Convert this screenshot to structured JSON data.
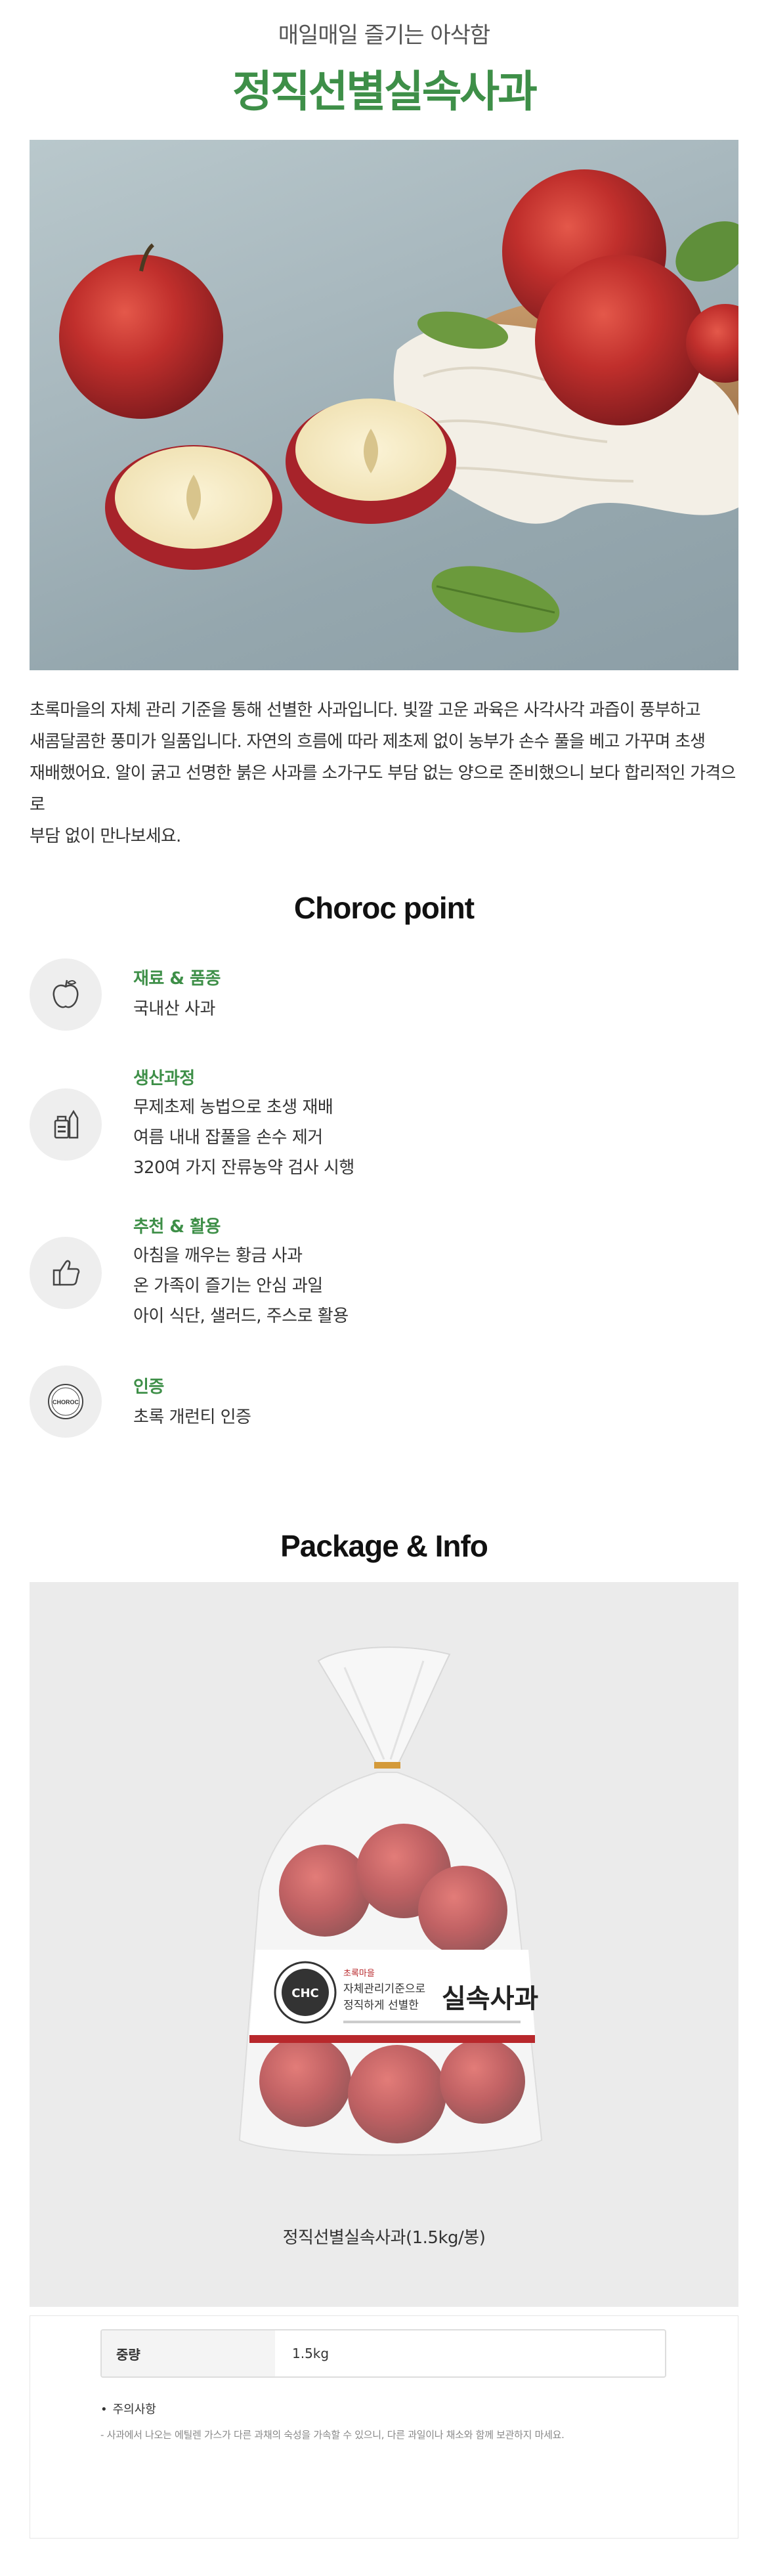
{
  "header": {
    "subtitle": "매일매일 즐기는 아삭함",
    "title": "정직선별실속사과"
  },
  "intro": {
    "lines": [
      "초록마을의 자체 관리 기준을 통해 선별한 사과입니다. 빛깔 고운 과육은 사각사각 과즙이 풍부하고",
      "새콤달콤한 풍미가 일품입니다. 자연의 흐름에 따라 제초제 없이 농부가 손수 풀을 베고 가꾸며 초생",
      "재배했어요. 알이 굵고 선명한 붉은 사과를 소가구도 부담 없는 양으로 준비했으니 보다 합리적인 가격으로",
      "부담 없이 만나보세요."
    ]
  },
  "points": {
    "heading": "Choroc point",
    "items": [
      {
        "icon": "apple-icon",
        "title": "재료 & 품종",
        "lines": [
          "국내산 사과"
        ]
      },
      {
        "icon": "bottle-icon",
        "title": "생산과정",
        "lines": [
          "무제초제 농법으로 초생 재배",
          "여름 내내 잡풀을 손수 제거",
          "320여 가지 잔류농약 검사 시행"
        ]
      },
      {
        "icon": "thumbs-up-icon",
        "title": "추천 & 활용",
        "lines": [
          "아침을 깨우는 황금 사과",
          "온 가족이 즐기는 안심 과일",
          "아이 식단, 샐러드, 주스로 활용"
        ]
      },
      {
        "icon": "choroc-badge-icon",
        "title": "인증",
        "lines": [
          "초록 개런티 인증"
        ],
        "badge_text": "CHOROC"
      }
    ]
  },
  "package": {
    "heading": "Package & Info",
    "caption": "정직선별실속사과(1.5kg/봉)",
    "label_brand": "초록마을",
    "label_line1": "자체관리기준으로",
    "label_line2": "정직하게 선별한",
    "label_name": "실속사과"
  },
  "info": {
    "spec_key": "중량",
    "spec_value": "1.5kg",
    "notice_title": "주의사항",
    "notice_text": "- 사과에서 나오는 에틸렌 가스가 다른 과채의 숙성을 가속할 수 있으니, 다른 과일이나 채소와 함께 보관하지 마세요."
  },
  "colors": {
    "accent_green": "#3e8f48",
    "apple_red": "#b8282c",
    "icon_bg": "#eeeeee",
    "package_bg": "#ebebeb"
  }
}
